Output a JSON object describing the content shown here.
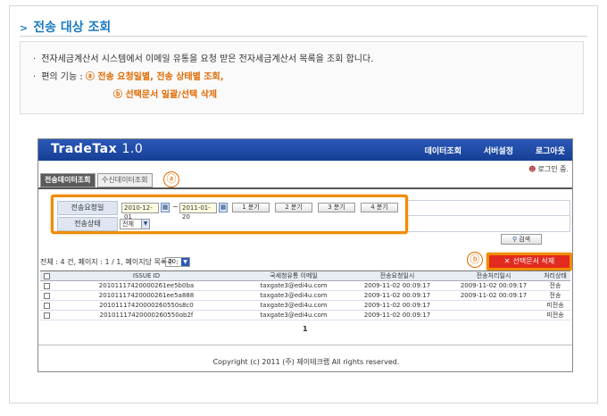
{
  "page": {
    "title": "전송 대상 조회",
    "desc_line1": "전자세금계산서 시스템에서 이메일 유통을 요청 받은 전자세금계산서 목록을 조회 합니다.",
    "desc_line2_label": "편의 기능 :",
    "desc_line2_feature": "ⓐ 전송 요청일별, 전송 상태별 조회,",
    "desc_line3_feature": "ⓑ 선택문서 일괄/선택 삭제"
  },
  "app": {
    "logo": "TradeTax",
    "version": "1.0",
    "nav": [
      "데이터조회",
      "서버설정",
      "로그아웃"
    ],
    "login_status": "로그인 중."
  },
  "tabs": {
    "active": "전송데이터조회",
    "inactive": "수신데이터조회"
  },
  "markers": {
    "a": "ⓐ",
    "b": "ⓑ"
  },
  "search": {
    "date_label": "전송요청일",
    "date_from": "2010-12-01",
    "tilde": "~",
    "date_to": "2011-01-20",
    "quarters": [
      "1 분기",
      "2 분기",
      "3 분기",
      "4 분기"
    ],
    "status_label": "전송상태",
    "status_value": "전체",
    "search_button": "검색"
  },
  "list": {
    "summary": "전체 : 4 건,  페이지 : 1 / 1,  페이지당 목록수 :",
    "page_size": "20",
    "delete_button": "선택문서 삭제",
    "columns": [
      "ISSUE ID",
      "국세청유통 이메일",
      "전송요청일시",
      "전송처리일시",
      "처리상태"
    ],
    "rows": [
      [
        "20101117420000261ee5b0ba",
        "taxgate3@edi4u.com",
        "2009-11-02 00:09:17",
        "2009-11-02 00:09:17",
        "전송"
      ],
      [
        "20101117420000261ee5a888",
        "taxgate3@edi4u.com",
        "2009-11-02 00:09:17",
        "2009-11-02 00:09:17",
        "전송"
      ],
      [
        "20101117420000260550s8c0",
        "taxgate3@edi4u.com",
        "2009-11-02 00:09:17",
        "",
        "미전송"
      ],
      [
        "20101117420000260550ob2f",
        "taxgate3@edi4u.com",
        "2009-11-02 00:09:17",
        "",
        "미전송"
      ]
    ],
    "pager": "1"
  },
  "footer": {
    "copyright": "Copyright (c) 2011 (주) 제이테크랩 All rights reserved."
  }
}
